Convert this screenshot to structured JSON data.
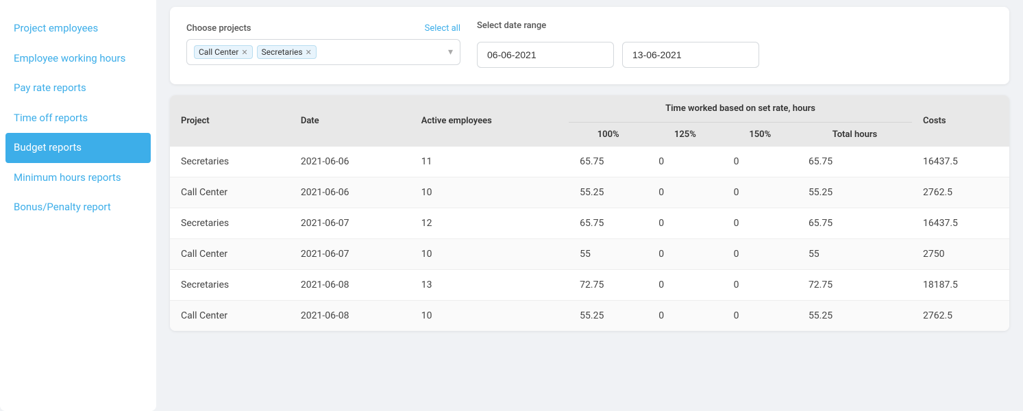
{
  "sidebar": {
    "items": [
      {
        "id": "project-employees",
        "label": "Project employees",
        "active": false
      },
      {
        "id": "employee-working-hours",
        "label": "Employee working hours",
        "active": false
      },
      {
        "id": "pay-rate-reports",
        "label": "Pay rate reports",
        "active": false
      },
      {
        "id": "time-off-reports",
        "label": "Time off reports",
        "active": false
      },
      {
        "id": "budget-reports",
        "label": "Budget reports",
        "active": true
      },
      {
        "id": "minimum-hours-reports",
        "label": "Minimum hours reports",
        "active": false
      },
      {
        "id": "bonus-penalty-report",
        "label": "Bonus/Penalty report",
        "active": false
      }
    ]
  },
  "filter": {
    "choose_projects_label": "Choose projects",
    "select_all_label": "Select all",
    "tags": [
      "Call Center",
      "Secretaries"
    ],
    "select_date_range_label": "Select date range",
    "date_from": "06-06-2021",
    "date_to": "13-06-2021"
  },
  "table": {
    "group_header": "Time worked based on set rate, hours",
    "columns": {
      "project": "Project",
      "date": "Date",
      "active_employees": "Active employees",
      "pct_100": "100%",
      "pct_125": "125%",
      "pct_150": "150%",
      "total_hours": "Total hours",
      "costs": "Costs"
    },
    "rows": [
      {
        "project": "Secretaries",
        "date": "2021-06-06",
        "active_employees": "11",
        "pct_100": "65.75",
        "pct_125": "0",
        "pct_150": "0",
        "total_hours": "65.75",
        "costs": "16437.5"
      },
      {
        "project": "Call Center",
        "date": "2021-06-06",
        "active_employees": "10",
        "pct_100": "55.25",
        "pct_125": "0",
        "pct_150": "0",
        "total_hours": "55.25",
        "costs": "2762.5"
      },
      {
        "project": "Secretaries",
        "date": "2021-06-07",
        "active_employees": "12",
        "pct_100": "65.75",
        "pct_125": "0",
        "pct_150": "0",
        "total_hours": "65.75",
        "costs": "16437.5"
      },
      {
        "project": "Call Center",
        "date": "2021-06-07",
        "active_employees": "10",
        "pct_100": "55",
        "pct_125": "0",
        "pct_150": "0",
        "total_hours": "55",
        "costs": "2750"
      },
      {
        "project": "Secretaries",
        "date": "2021-06-08",
        "active_employees": "13",
        "pct_100": "72.75",
        "pct_125": "0",
        "pct_150": "0",
        "total_hours": "72.75",
        "costs": "18187.5"
      },
      {
        "project": "Call Center",
        "date": "2021-06-08",
        "active_employees": "10",
        "pct_100": "55.25",
        "pct_125": "0",
        "pct_150": "0",
        "total_hours": "55.25",
        "costs": "2762.5"
      }
    ]
  }
}
